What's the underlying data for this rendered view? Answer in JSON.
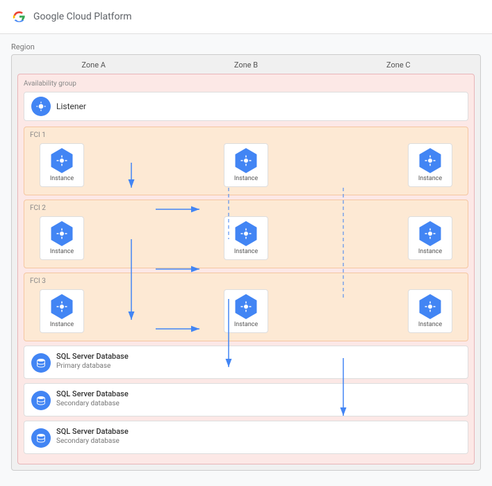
{
  "header": {
    "logo_alt": "Google Cloud Platform logo",
    "title": "Google Cloud Platform"
  },
  "region": {
    "label": "Region",
    "zones": [
      "Zone A",
      "Zone B",
      "Zone C"
    ],
    "availability_group_label": "Availability group",
    "listener_label": "Listener",
    "fci_sections": [
      {
        "label": "FCI 1",
        "instances": [
          {
            "label": "Instance",
            "zone": "A"
          },
          {
            "label": "Instance",
            "zone": "B"
          },
          {
            "label": "Instance",
            "zone": "C"
          }
        ]
      },
      {
        "label": "FCI 2",
        "instances": [
          {
            "label": "Instance",
            "zone": "A"
          },
          {
            "label": "Instance",
            "zone": "B"
          },
          {
            "label": "Instance",
            "zone": "C"
          }
        ]
      },
      {
        "label": "FCI 3",
        "instances": [
          {
            "label": "Instance",
            "zone": "A"
          },
          {
            "label": "Instance",
            "zone": "B"
          },
          {
            "label": "Instance",
            "zone": "C"
          }
        ]
      }
    ],
    "databases": [
      {
        "title": "SQL Server Database",
        "subtitle": "Primary database"
      },
      {
        "title": "SQL Server Database",
        "subtitle": "Secondary database"
      },
      {
        "title": "SQL Server Database",
        "subtitle": "Secondary database"
      }
    ]
  },
  "colors": {
    "blue": "#4285f4",
    "fci_bg": "#fde9d4",
    "fci_border": "#f5c6a0",
    "ag_bg": "#fce8e6",
    "ag_border": "#e8b4b8"
  }
}
